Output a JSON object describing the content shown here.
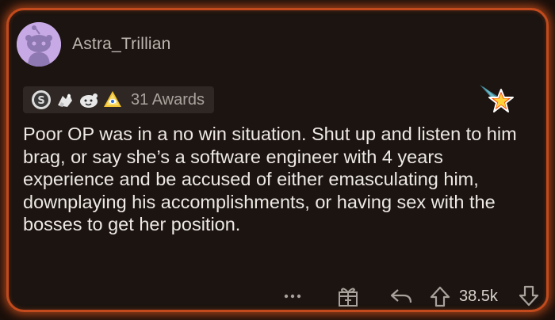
{
  "comment": {
    "username": "Astra_Trillian",
    "awards_label": "31 Awards",
    "body": "Poor OP was in a no win situation. Shut up and listen to him brag, or say she’s a software engineer with 4 years experience and be accused of either emasculating him, downplaying his accomplishments, or having sex with the bosses to get her position.",
    "score": "38.5k",
    "more_label": "•••"
  },
  "awards": [
    {
      "icon": "silver-award-icon"
    },
    {
      "icon": "helpful-award-icon"
    },
    {
      "icon": "wholesome-award-icon"
    },
    {
      "icon": "all-seeing-upvote-icon"
    }
  ],
  "colors": {
    "glow_border": "#c24a1c",
    "card_bg": "#1b1410",
    "avatar_bg": "#c7a9e6",
    "awards_bg": "#2e2724",
    "text": "#eee9e4",
    "muted": "#aaa39d"
  }
}
